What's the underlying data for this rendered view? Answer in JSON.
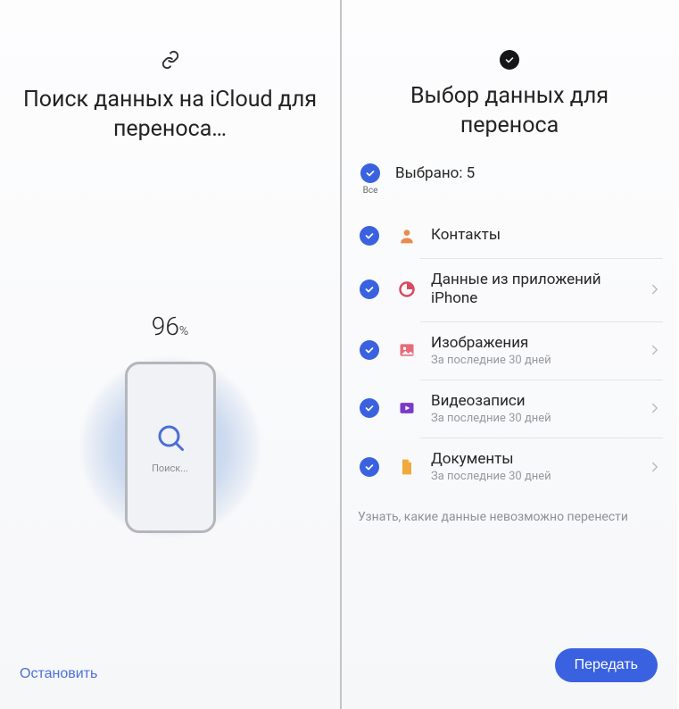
{
  "left": {
    "title": "Поиск данных на iCloud для переноса…",
    "progress_value": "96",
    "progress_unit": "%",
    "search_label": "Поиск...",
    "stop_label": "Остановить"
  },
  "right": {
    "title": "Выбор данных для переноса",
    "all_label": "Все",
    "selected_text": "Выбрано: 5",
    "items": [
      {
        "label": "Контакты",
        "sub": "",
        "icon": "contact",
        "icon_color": "#e98a4b",
        "has_chevron": false
      },
      {
        "label": "Данные из приложений iPhone",
        "sub": "",
        "icon": "appdata",
        "icon_color": "#d94a5f",
        "has_chevron": true
      },
      {
        "label": "Изображения",
        "sub": "За последние 30 дней",
        "icon": "image",
        "icon_color": "#e86b7a",
        "has_chevron": true
      },
      {
        "label": "Видеозаписи",
        "sub": "За последние 30 дней",
        "icon": "video",
        "icon_color": "#7a39c9",
        "has_chevron": true
      },
      {
        "label": "Документы",
        "sub": "За последние 30 дней",
        "icon": "document",
        "icon_color": "#f0a93c",
        "has_chevron": true
      }
    ],
    "info_link": "Узнать, какие данные невозможно перенести",
    "transfer_label": "Передать"
  }
}
